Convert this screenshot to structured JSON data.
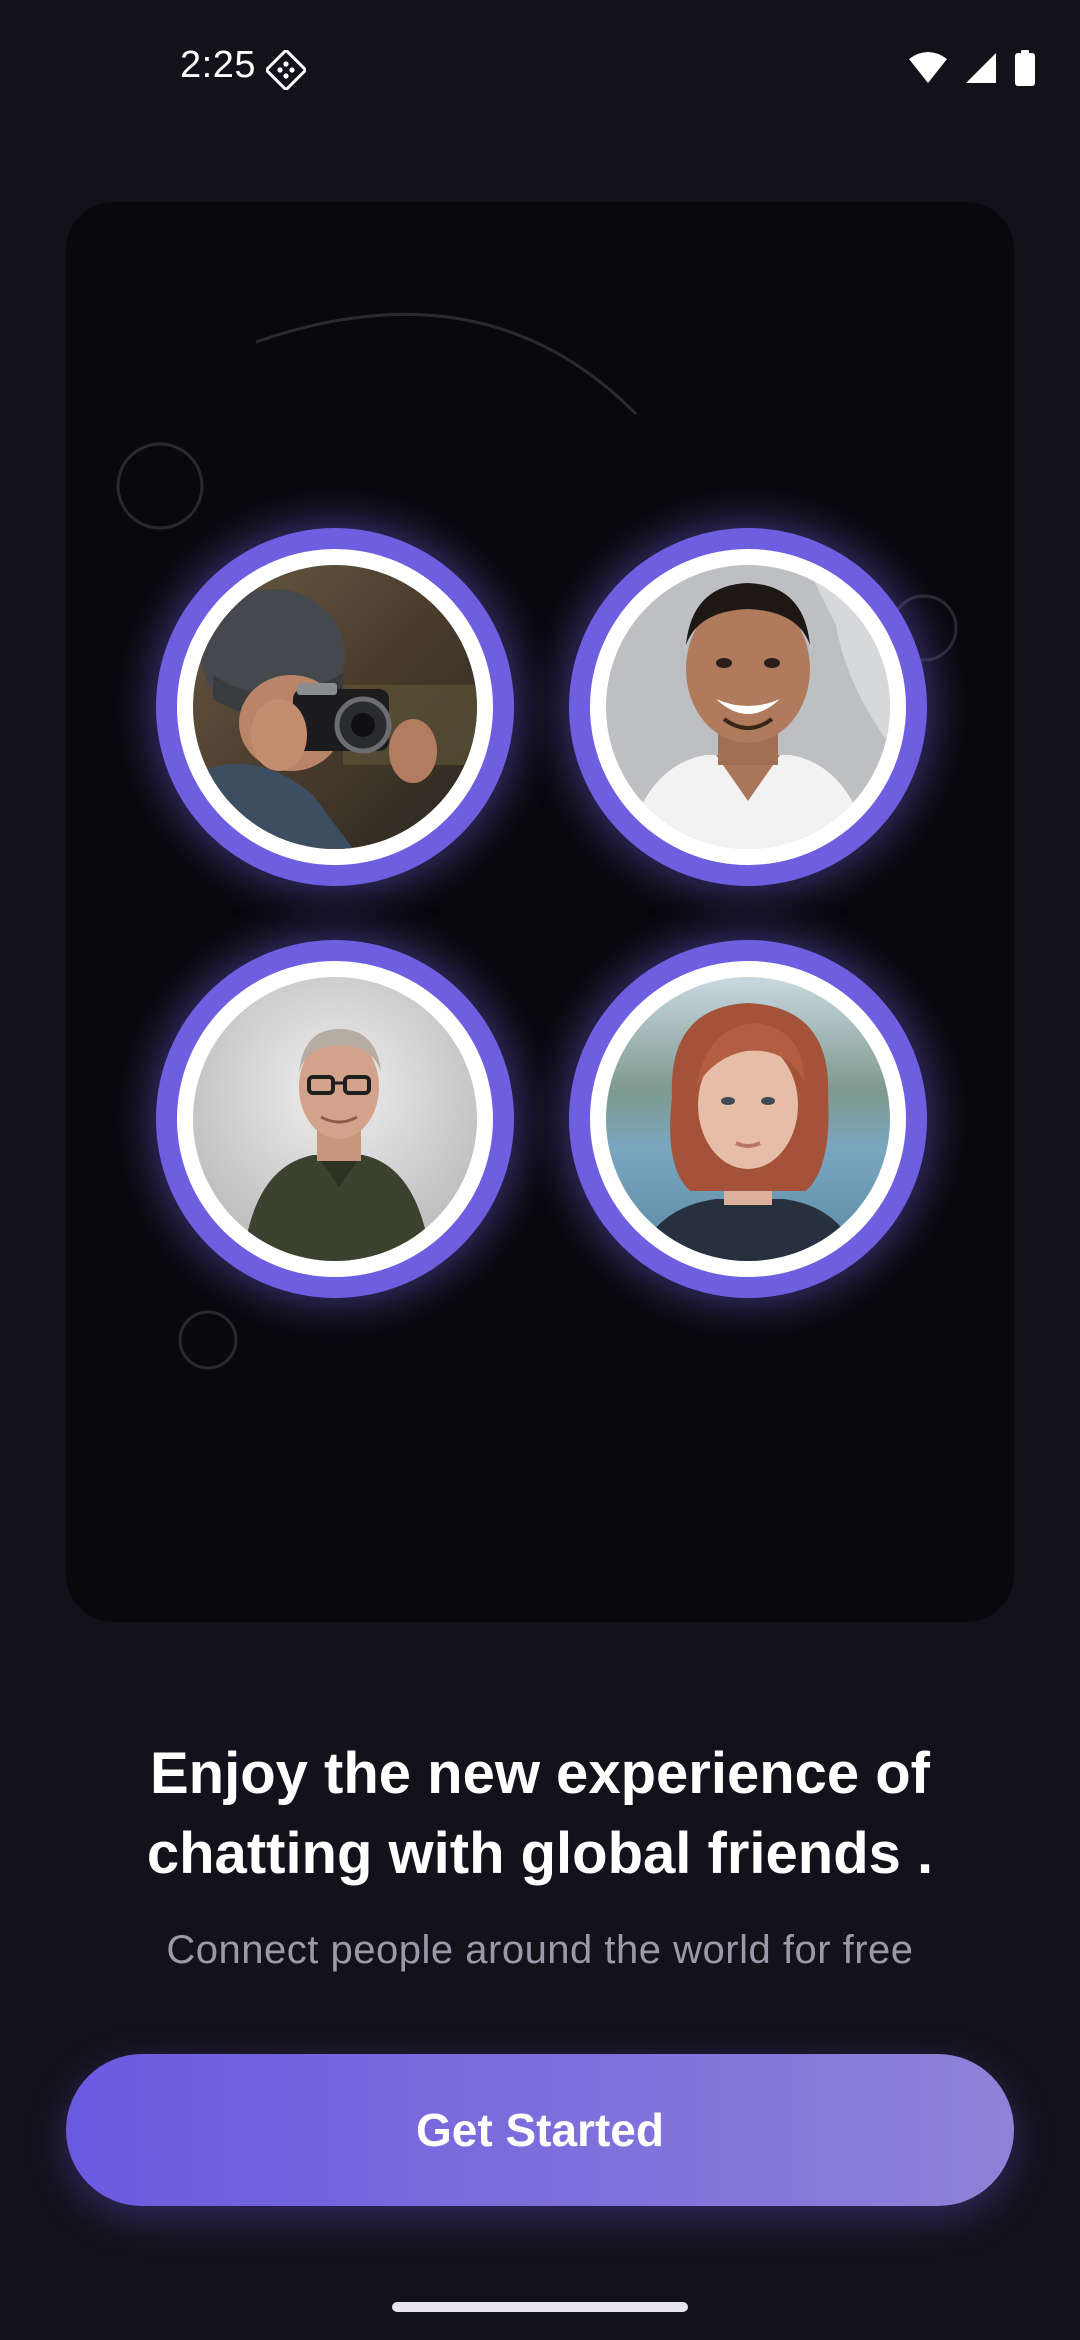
{
  "status_bar": {
    "time": "2:25",
    "notification_icon": "sim-toolkit-icon",
    "icons": [
      "wifi-icon",
      "signal-icon",
      "battery-icon"
    ]
  },
  "hero": {
    "avatars": [
      {
        "name": "avatar-photographer",
        "description_icon": "person-with-camera"
      },
      {
        "name": "avatar-smiling-man",
        "description_icon": "person-smiling"
      },
      {
        "name": "avatar-man-glasses",
        "description_icon": "person-glasses"
      },
      {
        "name": "avatar-red-hair-woman",
        "description_icon": "person-red-hair"
      }
    ]
  },
  "onboarding": {
    "headline_line1": "Enjoy the new experience of",
    "headline_line2": "chatting with global friends .",
    "subtitle": "Connect people around the world for free",
    "cta_label": "Get Started"
  },
  "colors": {
    "background": "#13111a",
    "card": "#09080c",
    "accent": "#6e5fe0",
    "button_start": "#6a5ae0",
    "button_end": "#8f82d8",
    "subtitle": "#9d99a8"
  }
}
